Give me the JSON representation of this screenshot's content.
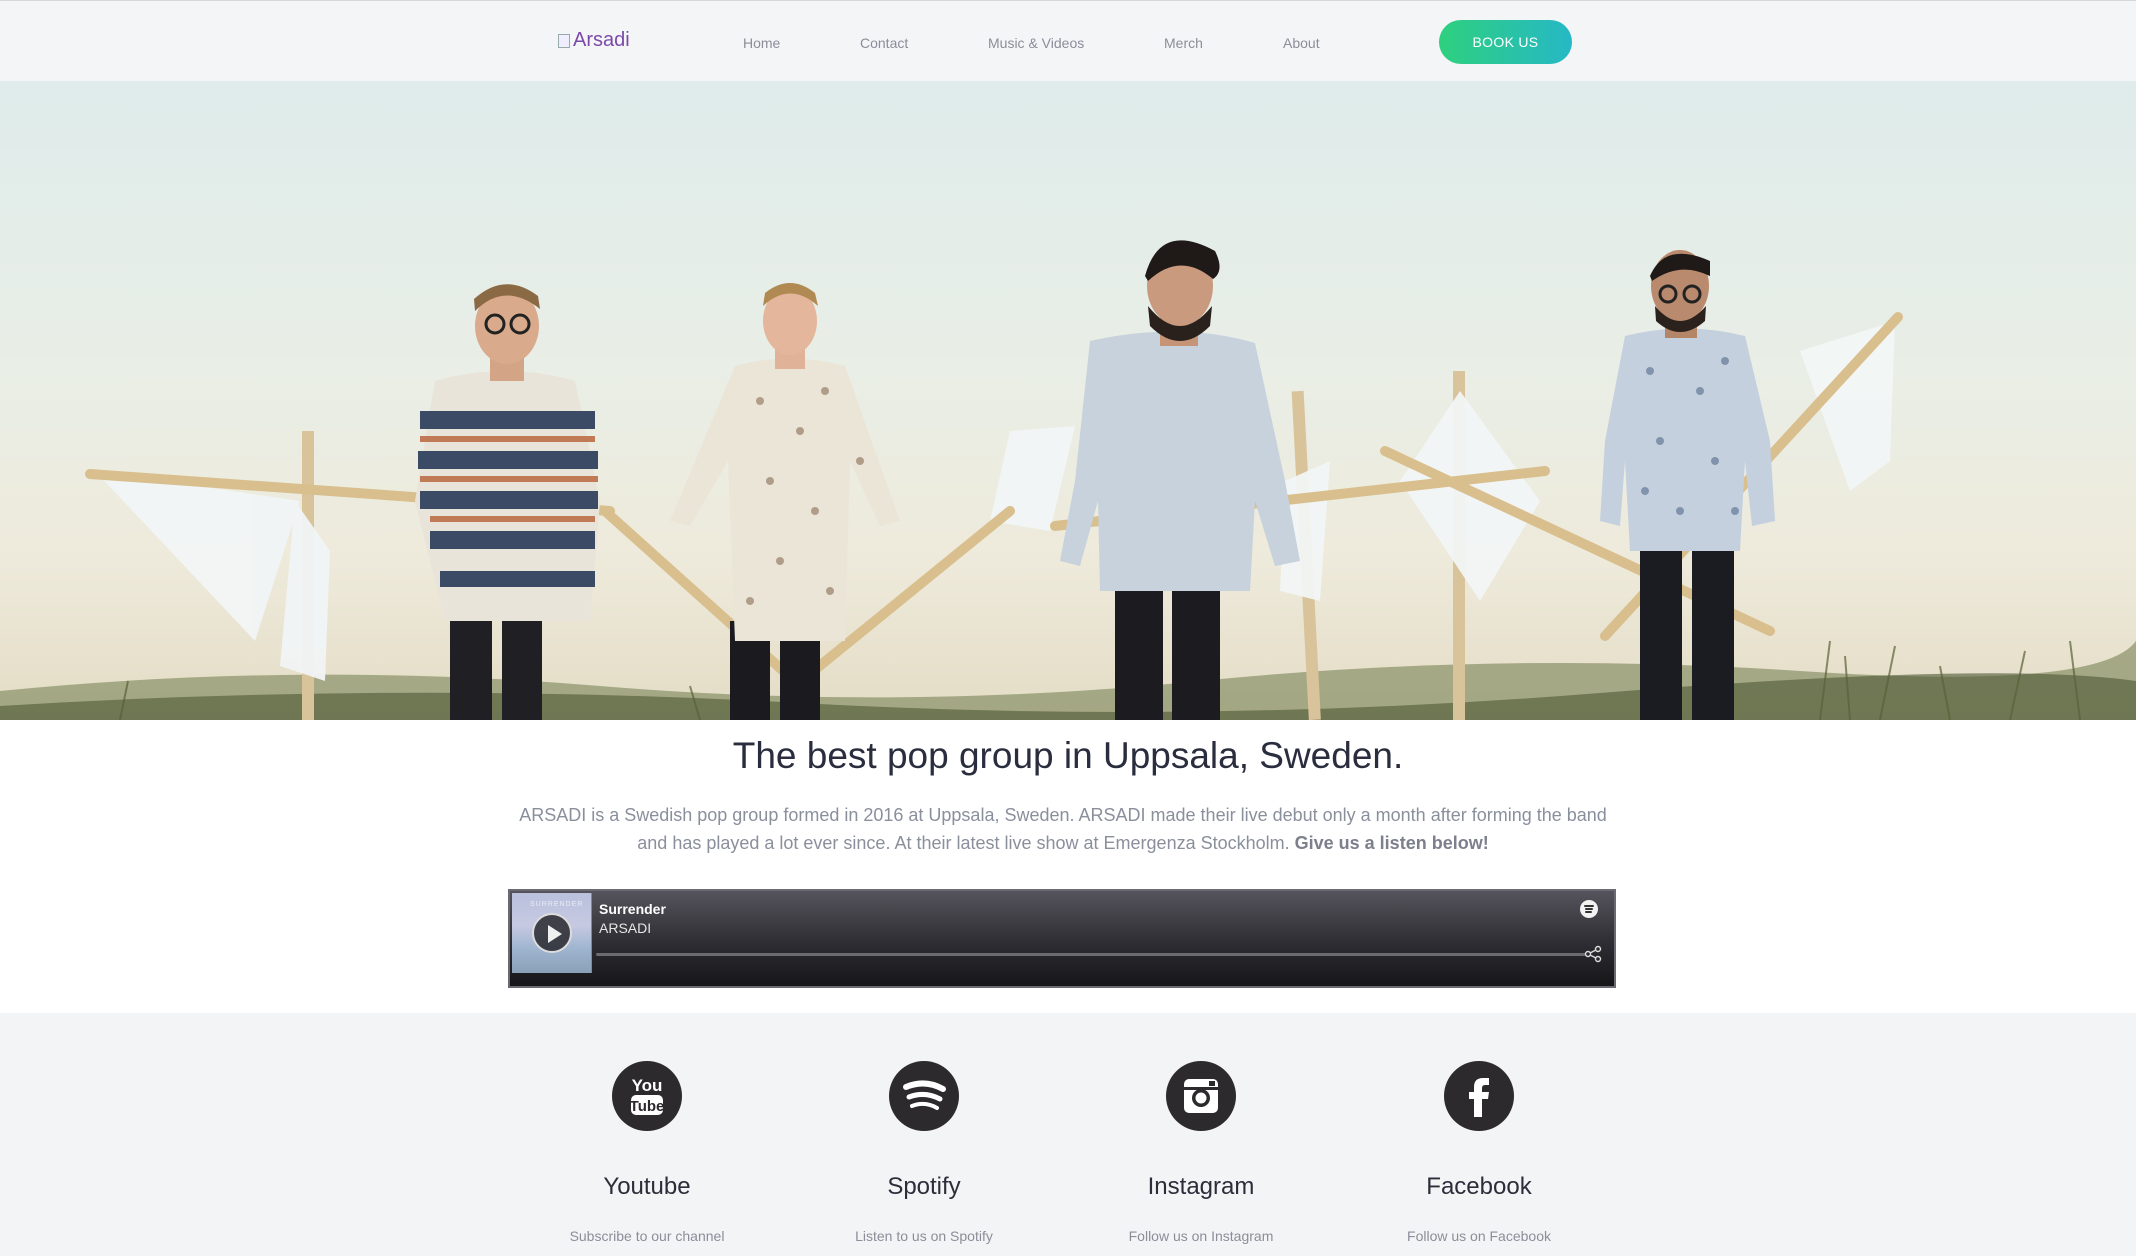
{
  "header": {
    "logo_alt": "Arsadi",
    "nav": [
      {
        "label": "Home"
      },
      {
        "label": "Contact"
      },
      {
        "label": "Music & Videos"
      },
      {
        "label": "Merch"
      },
      {
        "label": "About"
      }
    ],
    "cta_label": "BOOK US",
    "cta_gradient": [
      "#2ed07e",
      "#26b8c6"
    ]
  },
  "hero": {
    "image": "band-photo-four-members-with-white-flags"
  },
  "intro": {
    "headline": "The best pop group in Uppsala, Sweden.",
    "body": "ARSADI is a Swedish pop group formed in 2016 at Uppsala, Sweden. ARSADI made their live debut only a month after forming the band and has played a lot ever since. At their latest live show at Emergenza Stockholm.",
    "cta_text": "Give us a listen below!"
  },
  "player": {
    "track": "Surrender",
    "artist": "ARSADI",
    "cover_text": "SURRENDER",
    "icons": [
      "play-icon",
      "spotify-icon",
      "share-icon"
    ]
  },
  "social": [
    {
      "name": "Youtube",
      "sub": "Subscribe to our channel",
      "icon": "youtube-icon"
    },
    {
      "name": "Spotify",
      "sub": "Listen to us on Spotify",
      "icon": "spotify-icon"
    },
    {
      "name": "Instagram",
      "sub": "Follow us on Instagram",
      "icon": "instagram-icon"
    },
    {
      "name": "Facebook",
      "sub": "Follow us on Facebook",
      "icon": "facebook-icon"
    }
  ],
  "colors": {
    "header_bg": "#f4f5f7",
    "text_dark": "#2a2d3e",
    "text_muted": "#8a8f9c",
    "social_bg": "#f3f4f5",
    "icon_circle": "#2c2a2d"
  }
}
